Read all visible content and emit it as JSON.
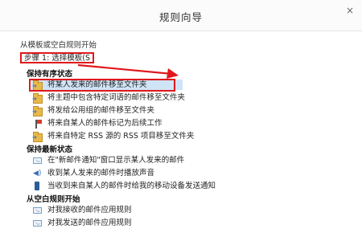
{
  "window": {
    "title": "规则向导",
    "close": "×"
  },
  "intro": {
    "from_label": "从模板或空白规则开始",
    "step_label": "步骤 1: 选择模板(S"
  },
  "groups": [
    {
      "header": "保持有序状态",
      "items": [
        {
          "label": "将某人发来的邮件移至文件夹",
          "icon": "folder-move-icon",
          "selected": true
        },
        {
          "label": "将主题中包含特定词语的邮件移至文件夹",
          "icon": "folder-move-icon"
        },
        {
          "label": "将发给公用组的邮件移至文件夹",
          "icon": "folder-move-icon"
        },
        {
          "label": "将来自某人的邮件标记为后续工作",
          "icon": "flag-icon"
        },
        {
          "label": "将来自特定 RSS 源的 RSS 项目移至文件夹",
          "icon": "folder-move-icon"
        }
      ]
    },
    {
      "header": "保持最新状态",
      "items": [
        {
          "label": "在\"新邮件通知\"窗口显示某人发来的邮件",
          "icon": "mail-notify-icon"
        },
        {
          "label": "收到某人发来的邮件时播放声音",
          "icon": "speaker-icon"
        },
        {
          "label": "当收到来自某人的邮件时给我的移动设备发送通知",
          "icon": "mobile-icon"
        }
      ]
    },
    {
      "header": "从空白规则开始",
      "items": [
        {
          "label": "对我接收的邮件应用规则",
          "icon": "envelope-icon"
        },
        {
          "label": "对我发送的邮件应用规则",
          "icon": "envelope-send-icon"
        }
      ]
    }
  ],
  "colors": {
    "highlight_red": "#e0181c",
    "selection_blue": "#cfe4f7"
  }
}
